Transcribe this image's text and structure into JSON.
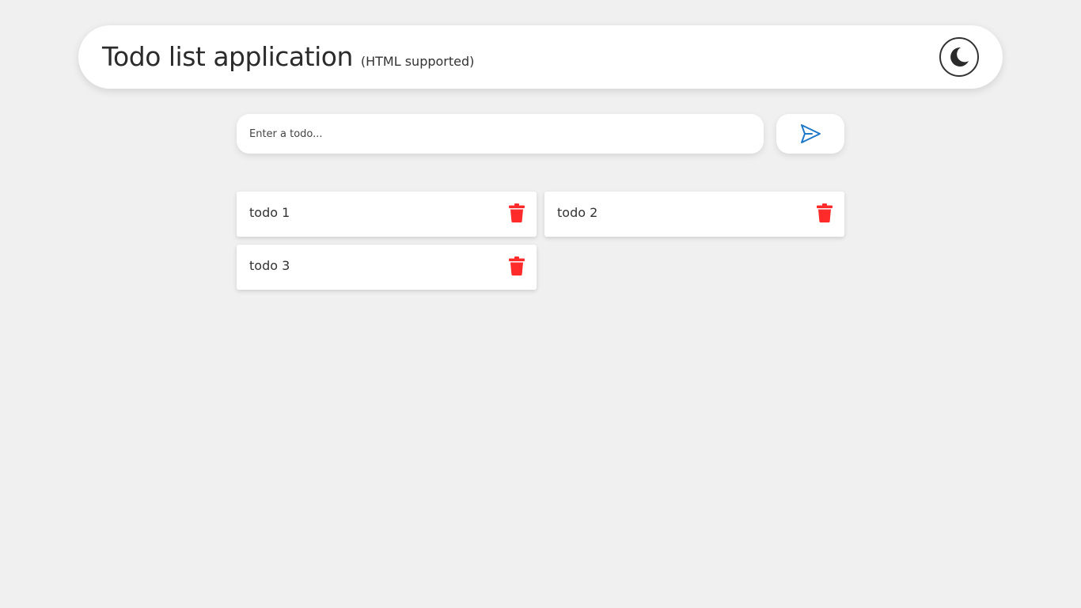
{
  "header": {
    "title": "Todo list application",
    "subtitle": "(HTML supported)",
    "theme_toggle_icon": "moon-icon"
  },
  "input": {
    "placeholder": "Enter a todo...",
    "value": ""
  },
  "send_button": {
    "icon": "send-icon",
    "color": "#1e78c8"
  },
  "todos": [
    {
      "text": "todo 1"
    },
    {
      "text": "todo 2"
    },
    {
      "text": "todo 3"
    }
  ],
  "colors": {
    "background": "#f0f0f0",
    "delete": "#ff2b2b",
    "accent": "#1e78c8"
  }
}
